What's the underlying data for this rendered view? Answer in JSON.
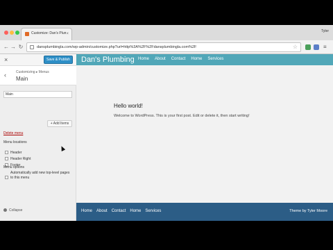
{
  "browser": {
    "tab_title": "Customize: Dan's Plumbing",
    "tab_close": "×",
    "profile": "Tyler",
    "url": "dansplumbingla.com/wp-admin/customize.php?url=http%3A%2F%2Fdansplumbingla.com%2F",
    "nav_back": "←",
    "nav_forward": "→",
    "nav_reload": "↻",
    "star": "☆",
    "menu": "≡"
  },
  "customizer": {
    "close": "×",
    "save_button": "Save & Publish",
    "back": "‹",
    "breadcrumb": "Customizing ▸ Menus",
    "panel_title": "Main",
    "menu_name_value": "Main",
    "add_items": "+ Add Items",
    "delete_menu": "Delete menu",
    "menu_locations_label": "Menu locations",
    "locations": [
      "Header",
      "Header Right",
      "Footer"
    ],
    "menu_options_label": "Menu options",
    "auto_add": "Automatically add new top-level pages to this menu",
    "collapse": "Collapse"
  },
  "site": {
    "title": "Dan's Plumbing",
    "nav": [
      "Home",
      "About",
      "Contact",
      "Home",
      "Services"
    ],
    "post_title": "Hello world!",
    "post_body": "Welcome to WordPress. This is your first post. Edit or delete it, then start writing!",
    "footer_nav": [
      "Home",
      "About",
      "Contact",
      "Home",
      "Services"
    ],
    "footer_credit": "Theme by Tyler Moore"
  },
  "colors": {
    "header_bg": "#51a7b8",
    "footer_bg": "#2c5d86",
    "save_button": "#2e8fc7"
  }
}
